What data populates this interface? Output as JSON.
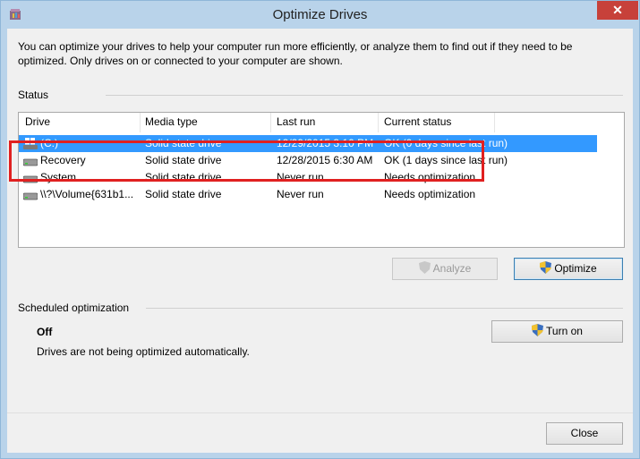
{
  "window": {
    "title": "Optimize Drives",
    "close_glyph": "✕"
  },
  "intro": "You can optimize your drives to help your computer run more efficiently, or analyze them to find out if they need to be optimized. Only drives on or connected to your computer are shown.",
  "status": {
    "label": "Status",
    "columns": [
      "Drive",
      "Media type",
      "Last run",
      "Current status"
    ],
    "rows": [
      {
        "drive": "(C:)",
        "media": "Solid state drive",
        "last_run": "12/29/2015 3:10 PM",
        "status": "OK (0 days since last run)",
        "icon": "windows-drive-icon",
        "selected": true
      },
      {
        "drive": "Recovery",
        "media": "Solid state drive",
        "last_run": "12/28/2015 6:30 AM",
        "status": "OK (1 days since last run)",
        "icon": "drive-icon",
        "selected": false
      },
      {
        "drive": "System",
        "media": "Solid state drive",
        "last_run": "Never run",
        "status": "Needs optimization",
        "icon": "drive-icon",
        "selected": false
      },
      {
        "drive": "\\\\?\\Volume{631b1...",
        "media": "Solid state drive",
        "last_run": "Never run",
        "status": "Needs optimization",
        "icon": "drive-icon",
        "selected": false
      }
    ]
  },
  "buttons": {
    "analyze": "Analyze",
    "optimize": "Optimize",
    "turn_on": "Turn on",
    "close": "Close"
  },
  "scheduled": {
    "label": "Scheduled optimization",
    "state": "Off",
    "description": "Drives are not being optimized automatically."
  },
  "colors": {
    "selection": "#3399ff",
    "highlight": "#e02020",
    "titlebar": "#b9d3ea",
    "close": "#c7413a"
  }
}
